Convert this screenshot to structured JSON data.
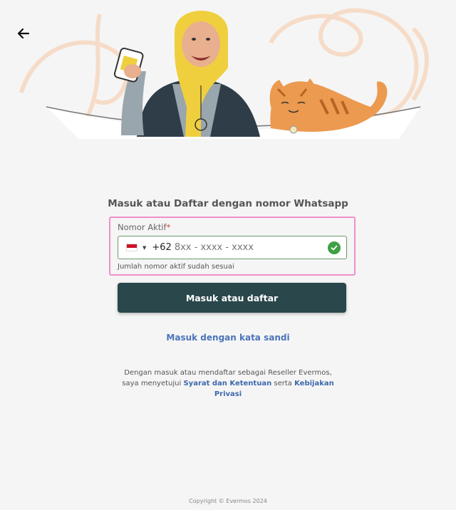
{
  "header": {
    "back_icon": "arrow-left-icon"
  },
  "hero": {
    "illustration": "woman-with-phone-and-cat-illustration"
  },
  "form": {
    "title": "Masuk atau Daftar dengan nomor Whatsapp",
    "field_label": "Nomor Aktif",
    "required_mark": "*",
    "country_flag": "indonesia-flag-icon",
    "dropdown_icon": "caret-down-icon",
    "country_code": "+62",
    "phone_placeholder": "8xx - xxxx - xxxx",
    "valid_icon": "check-circle-icon",
    "hint": "Jumlah nomor aktif sudah sesuai",
    "highlight_color": "#f08fc9"
  },
  "actions": {
    "submit_label": "Masuk atau daftar",
    "submit_color": "#2a474b",
    "password_link": "Masuk dengan kata sandi"
  },
  "terms": {
    "prefix": "Dengan masuk atau mendaftar sebagai Reseller Evermos, saya menyetujui",
    "terms_link": "Syarat dan Ketentuan",
    "connector": "serta",
    "privacy_link": "Kebijakan Privasi"
  },
  "footer": {
    "copyright": "Copyright © Evermos 2024"
  }
}
